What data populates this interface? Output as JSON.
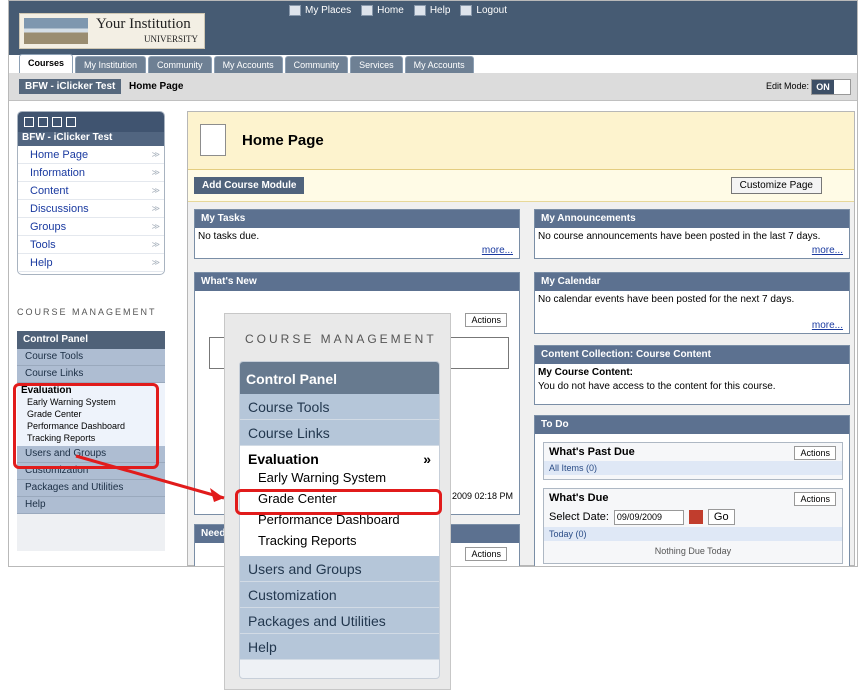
{
  "header": {
    "institution_title": "Your Institution",
    "institution_sub": "UNIVERSITY",
    "links": [
      "My Places",
      "Home",
      "Help",
      "Logout"
    ],
    "tabs": [
      "Courses",
      "My Institution",
      "Community",
      "My Accounts",
      "Community",
      "Services",
      "My Accounts"
    ]
  },
  "breadcrumb": {
    "course": "BFW - iClicker Test",
    "page": "Home Page"
  },
  "edit_mode": {
    "label": "Edit Mode:",
    "state": "ON"
  },
  "course_menu": {
    "title": "BFW - iClicker Test",
    "items": [
      "Home Page",
      "Information",
      "Content",
      "Discussions",
      "Groups",
      "Tools",
      "Help"
    ]
  },
  "management": {
    "title": "COURSE MANAGEMENT",
    "control_panel": "Control Panel",
    "items": [
      "Course Tools",
      "Course Links"
    ],
    "evaluation": {
      "title": "Evaluation",
      "links": [
        "Early Warning System",
        "Grade Center",
        "Performance Dashboard",
        "Tracking Reports"
      ]
    },
    "after_items": [
      "Users and Groups",
      "Customization",
      "Packages and Utilities",
      "Help"
    ]
  },
  "main": {
    "page_title": "Home Page",
    "add_module": "Add Course Module",
    "customize": "Customize Page"
  },
  "modules": {
    "tasks": {
      "title": "My Tasks",
      "text": "No tasks due.",
      "more": "more..."
    },
    "whats_new": {
      "title": "What's New",
      "actions": "Actions",
      "time": "2009 02:18 PM"
    },
    "needs": {
      "title": "Need",
      "actions": "Actions"
    },
    "announcements": {
      "title": "My Announcements",
      "text": "No course announcements have been posted in the last 7 days.",
      "more": "more..."
    },
    "calendar": {
      "title": "My Calendar",
      "text": "No calendar events have been posted for the next 7 days.",
      "more": "more..."
    },
    "collection": {
      "title": "Content Collection: Course Content",
      "label": "My Course Content:",
      "text": "You do not have access to the content for this course."
    },
    "todo": {
      "title": "To Do",
      "past_due": "What's Past Due",
      "actions": "Actions",
      "all_items": "All Items (0)",
      "due": "What's Due",
      "select_date": "Select Date:",
      "date": "09/09/2009",
      "go": "Go",
      "today": "Today (0)",
      "nothing": "Nothing Due Today"
    }
  },
  "colors": {
    "highlight": "#e11b1b",
    "nav_blue": "#4f6178"
  }
}
